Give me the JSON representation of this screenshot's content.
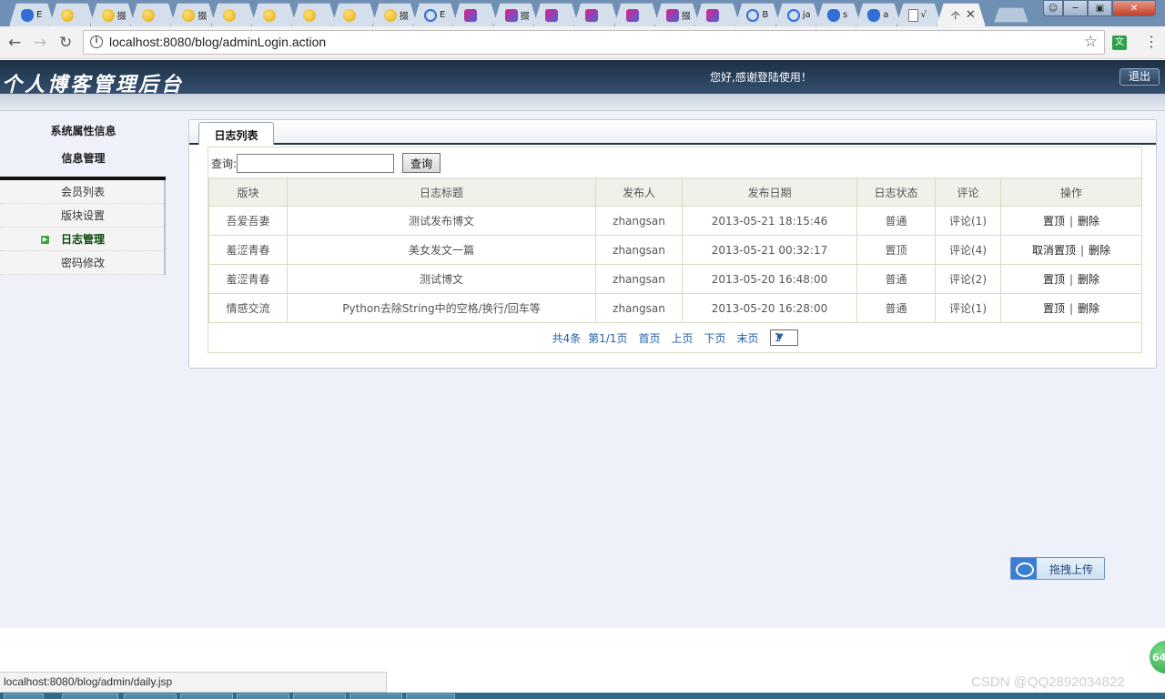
{
  "browser": {
    "tabs": [
      {
        "favicon": "paw-icon",
        "title": "E"
      },
      {
        "favicon": "yellow-icon",
        "title": ""
      },
      {
        "favicon": "yellow-icon",
        "title": "掇"
      },
      {
        "favicon": "yellow-icon",
        "title": ""
      },
      {
        "favicon": "yellow-icon",
        "title": "掇"
      },
      {
        "favicon": "yellow-icon",
        "title": ""
      },
      {
        "favicon": "yellow-icon",
        "title": ""
      },
      {
        "favicon": "yellow-icon",
        "title": ""
      },
      {
        "favicon": "yellow-icon",
        "title": ""
      },
      {
        "favicon": "yellow-icon",
        "title": "掇"
      },
      {
        "favicon": "cloud-icon",
        "title": "E"
      },
      {
        "favicon": "pink-icon",
        "title": ""
      },
      {
        "favicon": "pink-icon",
        "title": "掇"
      },
      {
        "favicon": "pink-icon",
        "title": ""
      },
      {
        "favicon": "pink-icon",
        "title": ""
      },
      {
        "favicon": "pink-icon",
        "title": ""
      },
      {
        "favicon": "pink-icon",
        "title": "掇"
      },
      {
        "favicon": "pink-icon",
        "title": ""
      },
      {
        "favicon": "cloud-icon",
        "title": "B"
      },
      {
        "favicon": "cloud-icon",
        "title": "ja"
      },
      {
        "favicon": "paw-icon",
        "title": "s"
      },
      {
        "favicon": "paw-icon",
        "title": "a"
      },
      {
        "favicon": "doc-icon",
        "title": "√"
      },
      {
        "favicon": "none",
        "title": "个"
      }
    ],
    "address": "localhost:8080/blog/adminLogin.action",
    "translate_label": "文",
    "status_url": "localhost:8080/blog/admin/daily.jsp"
  },
  "header": {
    "logo_text": "个人博客管理后台",
    "greeting": "您好,感谢登陆使用！",
    "logout_label": "退出"
  },
  "sidebar": {
    "section1": "系统属性信息",
    "section2": "信息管理",
    "items": [
      {
        "label": "会员列表",
        "active": false
      },
      {
        "label": "版块设置",
        "active": false
      },
      {
        "label": "日志管理",
        "active": true
      },
      {
        "label": "密码修改",
        "active": false
      }
    ]
  },
  "panel": {
    "tab_label": "日志列表",
    "search_label": "查询:",
    "search_value": "",
    "search_button": "查询",
    "columns": [
      "版块",
      "日志标题",
      "发布人",
      "发布日期",
      "日志状态",
      "评论",
      "操作"
    ],
    "rows": [
      {
        "board": "吾爱吾妻",
        "title": "测试发布博文",
        "author": "zhangsan",
        "date": "2013-05-21 18:15:46",
        "status": "普通",
        "comments": "评论(1)",
        "op1": "置顶",
        "op2": "删除"
      },
      {
        "board": "羞涩青春",
        "title": "美女发文一篇",
        "author": "zhangsan",
        "date": "2013-05-21 00:32:17",
        "status": "置顶",
        "comments": "评论(4)",
        "op1": "取消置顶",
        "op2": "删除"
      },
      {
        "board": "羞涩青春",
        "title": "测试博文",
        "author": "zhangsan",
        "date": "2013-05-20 16:48:00",
        "status": "普通",
        "comments": "评论(2)",
        "op1": "置顶",
        "op2": "删除"
      },
      {
        "board": "情感交流",
        "title": "Python去除String中的空格/换行/回车等",
        "author": "zhangsan",
        "date": "2013-05-20 16:28:00",
        "status": "普通",
        "comments": "评论(1)",
        "op1": "置顶",
        "op2": "删除"
      }
    ],
    "op_separator": "|",
    "pager": {
      "total": "共4条",
      "page": "第1/1页",
      "first": "首页",
      "prev": "上页",
      "next": "下页",
      "last": "末页",
      "select_value": "1"
    }
  },
  "upload_label": "拖拽上传",
  "watermark": "CSDN @QQ2892034822",
  "badge_text": "64"
}
